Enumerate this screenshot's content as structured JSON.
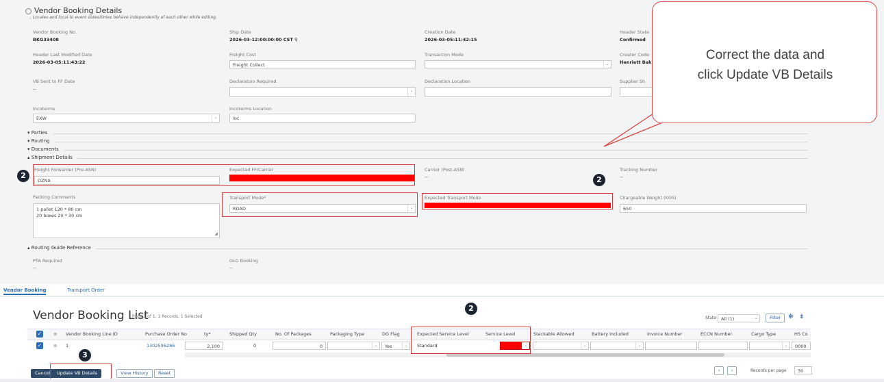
{
  "details": {
    "title": "Vendor Booking Details",
    "note": ", Locales and local to event dates/times behave independently of each other while editing.",
    "fields": {
      "vb_no_label": "Vendor Booking No.",
      "vb_no_value": "BKG33408",
      "ship_date_label": "Ship Date",
      "ship_date_value": "2026-03-12:00:00:00 CST",
      "creation_date_label": "Creation Date",
      "creation_date_value": "2026-03-05:11:42:15",
      "header_state_label": "Header State",
      "header_state_value": "Confirmed",
      "header_mod_label": "Header Last Modified Date",
      "header_mod_value": "2026-03-05:11:43:22",
      "freight_cost_label": "Freight Cost",
      "freight_cost_value": "Freight Collect",
      "transaction_mode_label": "Transaction Mode",
      "transaction_mode_value": "",
      "creator_code_label": "Creator Code",
      "creator_code_value": "Henriett Bak",
      "vb_sent_label": "VB Sent to FF Date",
      "vb_sent_value": "--",
      "declaration_req_label": "Declaration Required",
      "declaration_req_value": "",
      "declaration_loc_label": "Declaration Location",
      "declaration_loc_value": "",
      "supplier_label": "Supplier Sh",
      "supplier_value": "",
      "incoterms_label": "Incoterms",
      "incoterms_value": "EXW",
      "incoterms_loc_label": "Incoterms Location",
      "incoterms_loc_value": "loc"
    }
  },
  "sections": {
    "parties": "Parties",
    "routing": "Routing",
    "documents": "Documents",
    "shipment": "Shipment Details",
    "routing_guide": "Routing Guide Reference"
  },
  "shipment": {
    "ff_pre_asn_label": "Freight Forwarder (Pre-ASN)",
    "ff_pre_asn_value": "DZNA",
    "expected_ff_label": "Expected FF/Carrier",
    "expected_ff_value": "",
    "carrier_post_label": "Carrier (Post-ASN)",
    "carrier_post_value": "--",
    "tracking_label": "Tracking Number",
    "tracking_value": "--",
    "packing_label": "Packing Comments",
    "packing_line1": "1 pallet 120 * 80 cm",
    "packing_line2": "20 boxes 20 * 30 cm",
    "transport_mode_label": "Transport Mode*",
    "transport_mode_value": "ROAD",
    "exp_transport_label": "Expected Transport Mode",
    "exp_transport_value": "",
    "chargeable_label": "Chargeable Weight (KGS)",
    "chargeable_value": "650"
  },
  "routing_guide": {
    "pta_label": "PTA Required",
    "pta_value": "--",
    "glo_label": "GLO Booking",
    "glo_value": "--"
  },
  "tabs": {
    "vendor_booking": "Vendor Booking",
    "transport_order": "Transport Order"
  },
  "list": {
    "title": "Vendor Booking List",
    "subtitle": "Page 1 of 1, 1 Records, 1 Selected",
    "state_label": "State",
    "state_value": "All (1)",
    "filter_label": "Filter",
    "columns": [
      "Vendor Booking Line ID",
      "Purchase Order No",
      "ty*",
      "Shipped Qty",
      "No. Of Packages",
      "Packaging Type",
      "DG Flag",
      "Expected Service Level",
      "Service Level",
      "Stackable Allowed",
      "Battery Included",
      "Invoice Number",
      "ECCN Number",
      "Cargo Type",
      "HS Co"
    ],
    "row": {
      "line_id": "1",
      "po_no": "1302596286",
      "qty": "2,100",
      "shipped": "0",
      "packages": "0",
      "dg_flag": "Yes",
      "exp_service": "Standard",
      "hs_code": "0000"
    },
    "records_label": "Records per page",
    "records_value": "30"
  },
  "buttons": {
    "cancel": "Cancel",
    "update": "Update VB Details",
    "history": "View History",
    "reset": "Reset"
  },
  "badges": {
    "b1": "2",
    "b2": "2",
    "b3": "2",
    "b4": "3"
  },
  "callout": {
    "line1": "Correct the data and",
    "line2": "click Update VB Details"
  },
  "colors": {
    "highlight": "#ff0000",
    "annotation": "#d63c3c",
    "accent": "#2a6db7"
  }
}
